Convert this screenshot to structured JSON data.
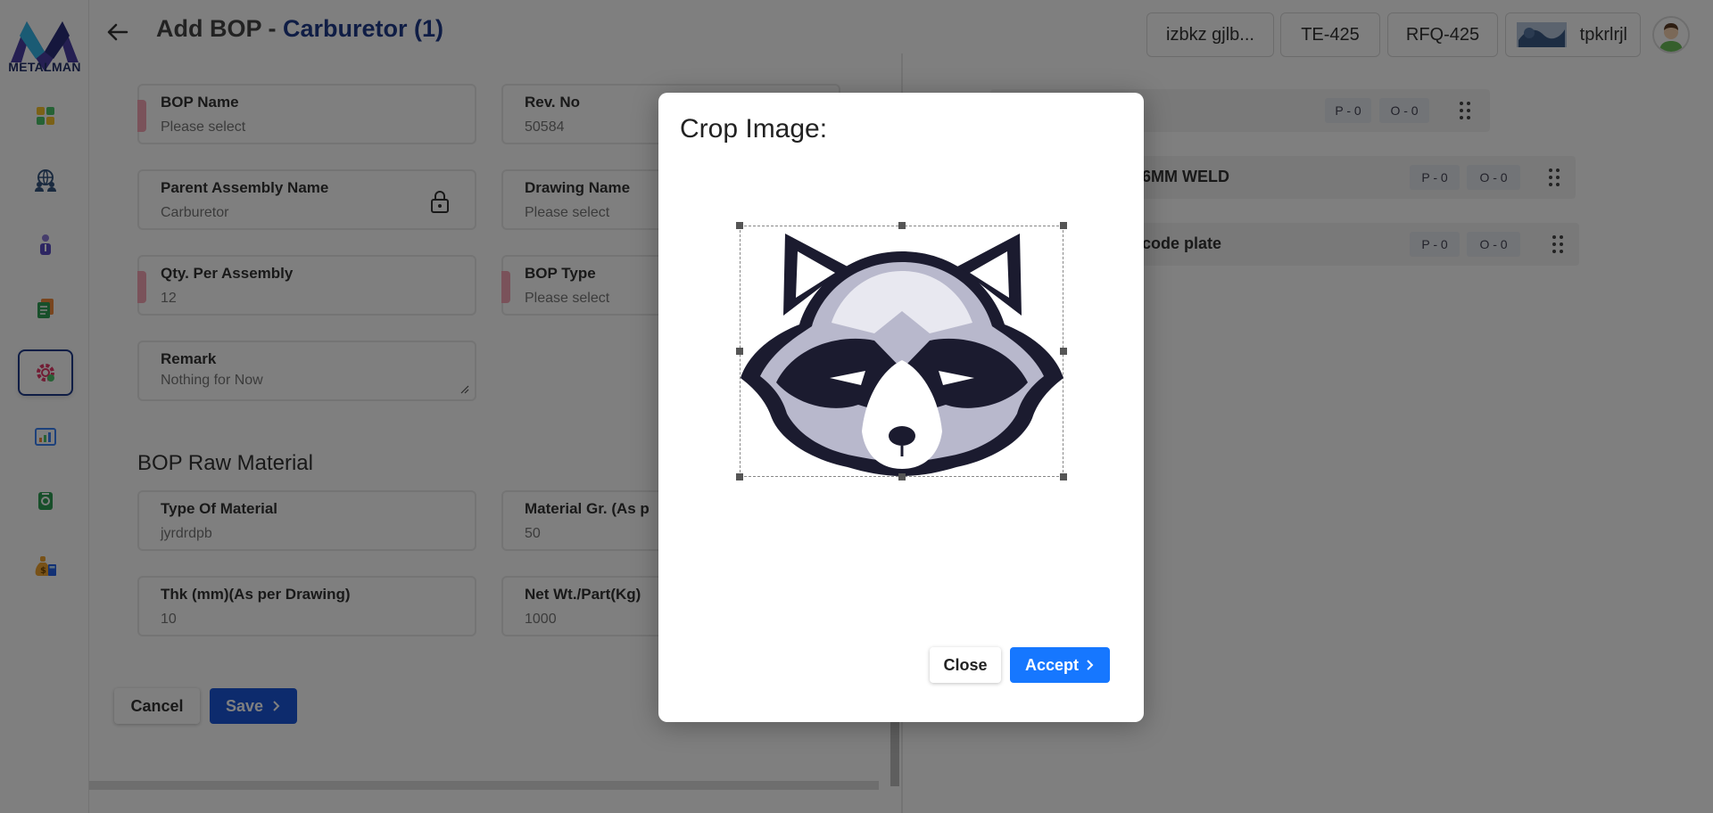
{
  "app": {
    "logo_text": "METALMAN"
  },
  "sidebar": {
    "items": [
      {
        "name": "dashboard-icon"
      },
      {
        "name": "globe-user-icon"
      },
      {
        "name": "user-icon"
      },
      {
        "name": "documents-icon"
      },
      {
        "name": "settings-gear-icon",
        "active": true
      },
      {
        "name": "analytics-chart-icon"
      },
      {
        "name": "camera-icon"
      },
      {
        "name": "money-bag-icon"
      }
    ]
  },
  "header": {
    "title_prefix": "Add BOP - ",
    "title_accent": "Carburetor (1)",
    "chips": [
      "izbkz gjlb...",
      "TE-425",
      "RFQ-425",
      "tpkrlrjl"
    ]
  },
  "form": {
    "bop_name": {
      "label": "BOP Name",
      "value": "Please select"
    },
    "rev_no": {
      "label": "Rev. No",
      "value": "50584"
    },
    "parent_assembly": {
      "label": "Parent Assembly Name",
      "value": "Carburetor"
    },
    "drawing_name": {
      "label": "Drawing Name",
      "value": "Please select"
    },
    "qty_per_assembly": {
      "label": "Qty. Per Assembly",
      "value": "12"
    },
    "bop_type": {
      "label": "BOP Type",
      "value": "Please select"
    },
    "remark": {
      "label": "Remark",
      "value": "Nothing for Now"
    },
    "raw_material_title": "BOP Raw Material",
    "type_of_material": {
      "label": "Type Of Material",
      "value": "jyrdrdpb"
    },
    "material_grade": {
      "label": "Material Gr. (As p",
      "value": "50"
    },
    "thickness": {
      "label": "Thk (mm)(As per Drawing)",
      "value": "10"
    },
    "net_weight": {
      "label": "Net Wt./Part(Kg)",
      "value": "1000"
    },
    "cancel_label": "Cancel",
    "save_label": "Save"
  },
  "tree": {
    "rows": [
      {
        "label": "",
        "p": "P - 0",
        "o": "O - 0"
      },
      {
        "label": "6MM WELD",
        "p": "P - 0",
        "o": "O - 0"
      },
      {
        "label": "code plate",
        "p": "P - 0",
        "o": "O - 0"
      }
    ]
  },
  "modal": {
    "title": "Crop Image:",
    "close_label": "Close",
    "accept_label": "Accept"
  },
  "colors": {
    "brand": "#1f3a8a",
    "primary_button": "#1677ff",
    "save_button": "#1a56db",
    "required_marker": "#f4a5b4"
  }
}
